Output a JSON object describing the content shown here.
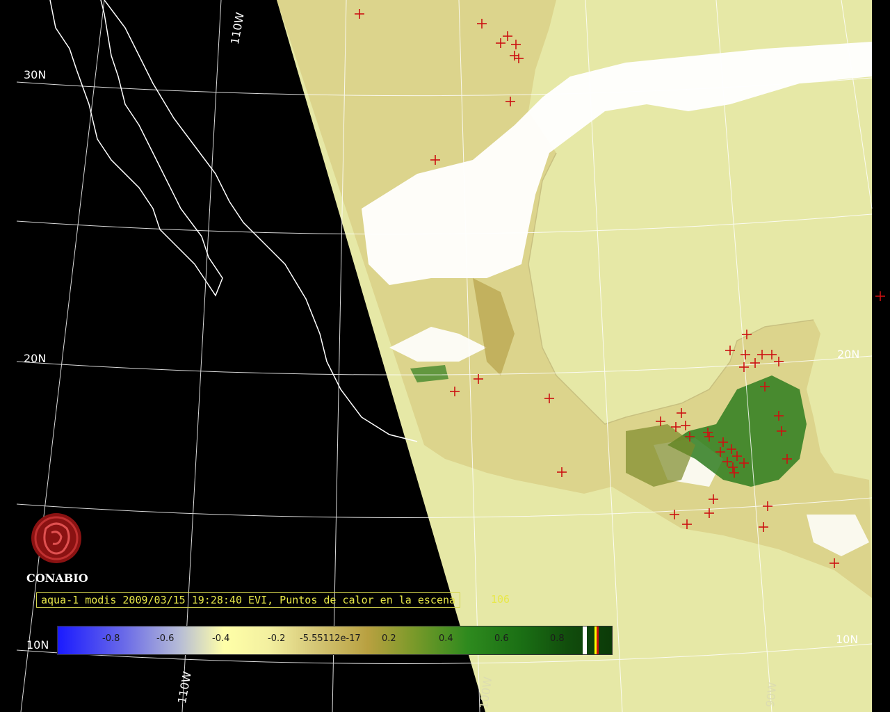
{
  "grid_labels": {
    "lat_30": "30N",
    "lat_20_west": "20N",
    "lat_20_east": "20N",
    "lat_10_west": "10N",
    "lat_10_east": "10N",
    "lon_110_top": "110W",
    "lon_110_bottom": "110W",
    "lon_100_bottom": "100W",
    "lon_90_bottom": "90W"
  },
  "caption": {
    "text": "aqua-1 modis 2009/03/15 19:28:40 EVI, Puntos de calor en la escena",
    "count": "106"
  },
  "colorbar": {
    "ticks": [
      "-0.8",
      "-0.6",
      "-0.4",
      "-0.2",
      "-5.55112e-17",
      "0.2",
      "0.4",
      "0.6",
      "0.8"
    ]
  },
  "logo": {
    "name": "CONABIO"
  },
  "colors": {
    "ocean": "#e6e8a6",
    "cloud": "#ffffff",
    "land": "#d9d28a",
    "vegetation": "#2e7d1e",
    "hotspot": "#cc1111",
    "grid": "#ffffff"
  },
  "icons": {
    "hotspot": "plus-marker",
    "logo": "conabio-emblem"
  }
}
